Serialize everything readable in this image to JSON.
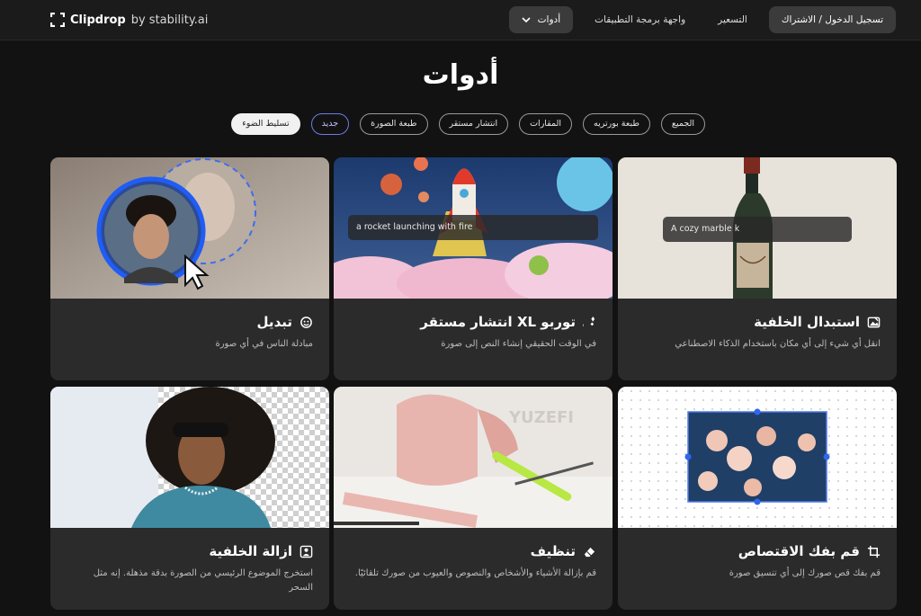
{
  "brand": {
    "name": "Clipdrop",
    "by": "by stability.ai"
  },
  "nav": {
    "login": "تسجيل الدخول / الاشتراك",
    "pricing": "التسعير",
    "api": "واجهة برمجة التطبيقات",
    "tools": "أدوات"
  },
  "page_title": "أدوات",
  "filters": [
    "الجميع",
    "طبعة بورتريه",
    "المقارات",
    "انتشار مستقر",
    "طبعة الصورة",
    "جديد",
    "تسليط الضوء"
  ],
  "cards": [
    {
      "title": "تبديل",
      "desc": "مبادلة الناس في أي صورة",
      "icon": "face-swap-icon"
    },
    {
      "title": "توربو XL انتشار مستقر",
      "desc": "في الوقت الحقيقي إنشاء النص إلى صورة",
      "icon": "text-to-image-icon",
      "prompt": "a rocket launching with fire"
    },
    {
      "title": "استبدال الخلفية",
      "desc": "انقل أي شيء إلى أي مكان باستخدام الذكاء الاصطناعي",
      "icon": "replace-background-icon",
      "prompt": "A cozy marble k"
    },
    {
      "title": "ازالة الخلفية",
      "desc": "استخرج الموضوع الرئيسي من الصورة بدقة مذهلة. إنه مثل السحر",
      "icon": "remove-background-icon"
    },
    {
      "title": "تنظيف",
      "desc": "قم بإزالة الأشياء والأشخاص والنصوص والعيوب من صورك تلقائيًا.",
      "icon": "eraser-icon"
    },
    {
      "title": "قم بفك الاقتصاص",
      "desc": "قم بفك قص صورك إلى أي تنسيق صورة",
      "icon": "uncrop-icon"
    }
  ]
}
